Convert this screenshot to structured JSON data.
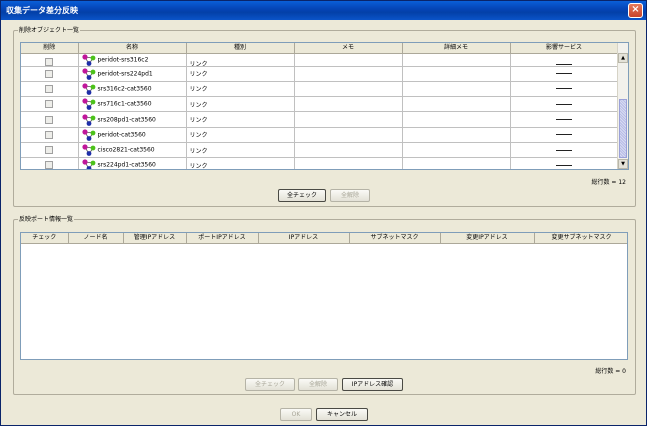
{
  "window": {
    "title": "収集データ差分反映"
  },
  "delete_panel": {
    "title": "削除オブジェクト一覧",
    "columns": [
      "削除",
      "名称",
      "種別",
      "メモ",
      "詳細メモ",
      "影響サービス"
    ],
    "rows": [
      {
        "name": "peridot-srs316c2",
        "type": "リンク"
      },
      {
        "name": "peridot-srs224pd1",
        "type": "リンク"
      },
      {
        "name": "srs316c2-cat3560",
        "type": "リンク"
      },
      {
        "name": "srs716c1-cat3560",
        "type": "リンク"
      },
      {
        "name": "srs208pd1-cat3560",
        "type": "リンク"
      },
      {
        "name": "peridot-cat3560",
        "type": "リンク"
      },
      {
        "name": "cisco2821-cat3560",
        "type": "リンク"
      },
      {
        "name": "srs224pd1-cat3560",
        "type": "リンク"
      }
    ],
    "count_label": "総行数 = 12",
    "check_all": "全チェック",
    "uncheck_all": "全解除"
  },
  "port_panel": {
    "title": "反映ポート情報一覧",
    "columns": [
      "チェック",
      "ノード名",
      "管理IPアドレス",
      "ポートIPアドレス",
      "IPアドレス",
      "サブネットマスク",
      "変更IPアドレス",
      "変更サブネットマスク"
    ],
    "count_label": "総行数 = 0",
    "check_all": "全チェック",
    "uncheck_all": "全解除",
    "confirm_ip": "IPアドレス確認"
  },
  "footer": {
    "ok": "OK",
    "cancel": "キャンセル"
  },
  "colors": {
    "title_bar": "#0545b8",
    "icon_magenta": "#c0169a",
    "icon_green": "#4cc21a",
    "icon_blue": "#1e2ea8"
  },
  "icons": {
    "close": "close-icon",
    "row_node": "link-node-icon"
  }
}
